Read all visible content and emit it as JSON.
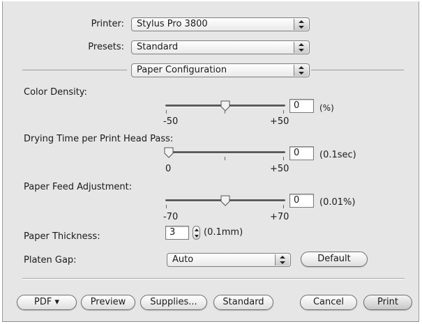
{
  "printer": {
    "label": "Printer:",
    "value": "Stylus Pro 3800"
  },
  "presets": {
    "label": "Presets:",
    "value": "Standard"
  },
  "section": {
    "value": "Paper Configuration"
  },
  "color_density": {
    "label": "Color Density:",
    "min_label": "-50",
    "max_label": "+50",
    "min": -50,
    "max": 50,
    "value": "0",
    "unit": "(%)"
  },
  "drying_time": {
    "label": "Drying Time per Print Head Pass:",
    "min_label": "0",
    "max_label": "+50",
    "min": 0,
    "max": 50,
    "value": "0",
    "unit": "(0.1sec)"
  },
  "paper_feed": {
    "label": "Paper Feed Adjustment:",
    "min_label": "-70",
    "max_label": "+70",
    "min": -70,
    "max": 70,
    "value": "0",
    "unit": "(0.01%)"
  },
  "paper_thickness": {
    "label": "Paper Thickness:",
    "value": "3",
    "unit": "(0.1mm)"
  },
  "platen_gap": {
    "label": "Platen Gap:",
    "value": "Auto",
    "default_button": "Default"
  },
  "buttons": {
    "pdf": "PDF ▾",
    "preview": "Preview",
    "supplies": "Supplies...",
    "standard": "Standard",
    "cancel": "Cancel",
    "print": "Print"
  },
  "icons": {
    "popup_arrows": "up-down-arrows-icon",
    "slider_thumb": "slider-thumb-icon",
    "stepper": "stepper-icon"
  }
}
